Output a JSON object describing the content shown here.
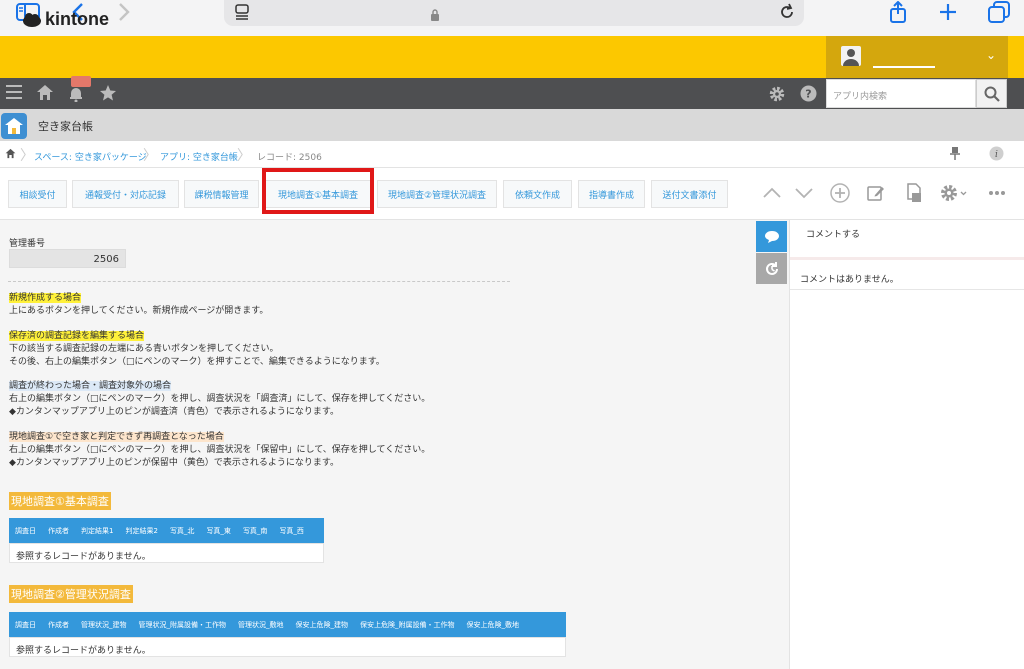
{
  "browser": {
    "url_text": ""
  },
  "header": {
    "logo_text": "kintone"
  },
  "nav": {
    "search_placeholder": "アプリ内検索"
  },
  "app": {
    "name": "空き家台帳"
  },
  "breadcrumb": {
    "space": "スペース: 空き家パッケージ",
    "app": "アプリ: 空き家台帳",
    "record": "レコード: 2506"
  },
  "tabs": [
    "相談受付",
    "通報受付・対応記録",
    "課税情報管理",
    "現地調査①基本調査",
    "現地調査②管理状況調査",
    "依頼文作成",
    "指導書作成",
    "送付文書添付"
  ],
  "record": {
    "mgmt_label": "管理番号",
    "mgmt_value": "2506"
  },
  "notes": [
    {
      "heading": "新規作成する場合",
      "lines": [
        "上にあるボタンを押してください。新規作成ページが開きます。"
      ]
    },
    {
      "heading": "保存済の調査記録を編集する場合",
      "lines": [
        "下の該当する調査記録の左端にある青いボタンを押してください。",
        "その後、右上の編集ボタン（□にペンのマーク）を押すことで、編集できるようになります。"
      ]
    },
    {
      "heading": "調査が終わった場合・調査対象外の場合",
      "lines": [
        "右上の編集ボタン（□にペンのマーク）を押し、調査状況を「調査済」にして、保存を押してください。",
        "◆カンタンマップアプリ上のピンが調査済（青色）で表示されるようになります。"
      ]
    },
    {
      "heading": "現地調査①で空き家と判定できず再調査となった場合",
      "lines": [
        "右上の編集ボタン（□にペンのマーク）を押し、調査状況を「保留中」にして、保存を押してください。",
        "◆カンタンマップアプリ上のピンが保留中（黄色）で表示されるようになります。"
      ]
    }
  ],
  "sections": [
    {
      "title": "現地調査①基本調査",
      "columns": [
        "調査日",
        "作成者",
        "判定結果1",
        "判定結果2",
        "写真_北",
        "写真_東",
        "写真_南",
        "写真_西"
      ],
      "empty_text": "参照するレコードがありません。"
    },
    {
      "title": "現地調査②管理状況調査",
      "columns": [
        "調査日",
        "作成者",
        "管理状況_建物",
        "管理状況_附属設備・工作物",
        "管理状況_敷地",
        "保安上危険_建物",
        "保安上危険_附属設備・工作物",
        "保安上危険_敷地"
      ],
      "empty_text": "参照するレコードがありません。"
    }
  ],
  "side": {
    "comment_prompt": "コメントする",
    "no_comments": "コメントはありません。"
  },
  "colors": {
    "header_yellow": "#fcc800",
    "nav_dark": "#4e4f51",
    "link_blue": "#3498db",
    "highlight_red": "#e01818",
    "section_orange": "#f3b93b"
  }
}
